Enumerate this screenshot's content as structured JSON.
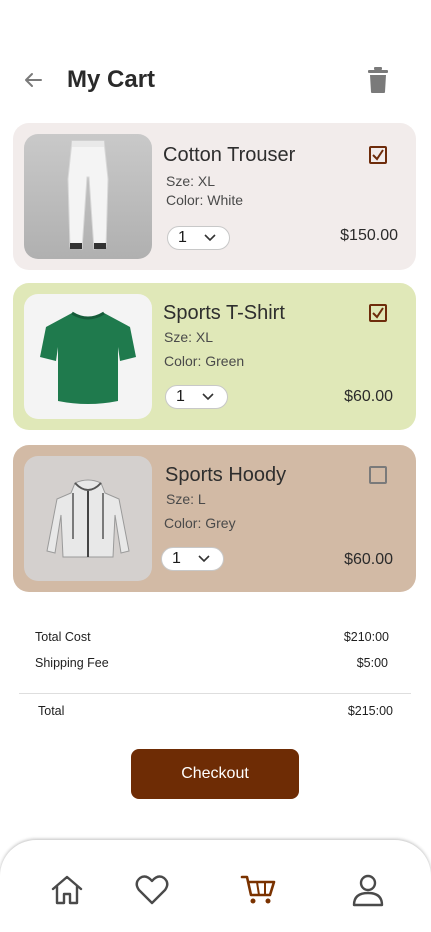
{
  "header": {
    "title": "My Cart",
    "back_icon": "arrow-left-icon",
    "delete_icon": "trash-icon"
  },
  "colors": {
    "accent": "#6e2c05",
    "card1": "#f2eceb",
    "card2": "#e0e8b8",
    "card3": "#d2baa5"
  },
  "cart": {
    "items": [
      {
        "name": "Cotton Trouser",
        "size": "Sze: XL",
        "color": "Color: White",
        "qty": "1",
        "price": "$150.00",
        "checked": true
      },
      {
        "name": "Sports T-Shirt",
        "size": "Sze: XL",
        "color": "Color: Green",
        "qty": "1",
        "price": "$60.00",
        "checked": true
      },
      {
        "name": "Sports Hoody",
        "size": "Sze: L",
        "color": "Color: Grey",
        "qty": "1",
        "price": "$60.00",
        "checked": false
      }
    ]
  },
  "summary": {
    "total_cost_label": "Total Cost",
    "total_cost_value": "$210:00",
    "shipping_label": "Shipping Fee",
    "shipping_value": "$5:00",
    "total_label": "Total",
    "total_value": "$215:00"
  },
  "checkout": {
    "label": "Checkout"
  },
  "nav": {
    "items": [
      "home-icon",
      "heart-icon",
      "cart-icon",
      "user-icon"
    ],
    "active": "cart-icon"
  }
}
